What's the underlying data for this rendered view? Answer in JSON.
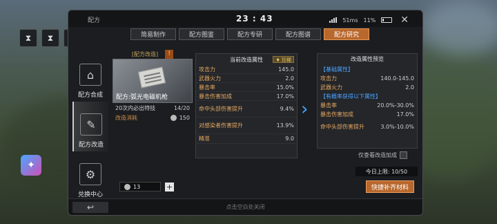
{
  "header": {
    "panel_title": "配方",
    "clock": "23 : 43",
    "network": "51ms",
    "battery": "11%",
    "close": "✕"
  },
  "tabs": [
    {
      "label": "简易制作",
      "active": false
    },
    {
      "label": "配方图鉴",
      "active": false
    },
    {
      "label": "配方专研",
      "active": false
    },
    {
      "label": "配方图谱",
      "active": false
    },
    {
      "label": "配方研究",
      "active": true
    }
  ],
  "sidebar": [
    {
      "label": "配方合成",
      "icon": "workbench-icon",
      "active": false
    },
    {
      "label": "配方改造",
      "icon": "clipboard-icon",
      "active": true
    },
    {
      "label": "兑换中心",
      "icon": "exchange-icon",
      "active": false
    }
  ],
  "blueprint": {
    "header": "[配方改造]",
    "info": "!",
    "name": "配方:弧光电磁机枪",
    "guarantee_label": "20次内必出特技",
    "guarantee_value": "14/20",
    "cost_label": "改造消耗",
    "cost_value": "150"
  },
  "current_stats": {
    "title": "当前改造属性",
    "badge": "珍稀",
    "rows": [
      {
        "key": "攻击力",
        "value": "145.0"
      },
      {
        "key": "武器火力",
        "value": "2.0"
      },
      {
        "key": "暴击率",
        "value": "15.0%"
      },
      {
        "key": "暴击伤害加成",
        "value": "17.0%"
      },
      {
        "key": "命中头部伤害提升",
        "value": "9.4%"
      },
      {
        "key": "对感染者伤害提升",
        "value": "13.9%"
      },
      {
        "key": "精准",
        "value": "9.0"
      }
    ]
  },
  "preview": {
    "title": "改造属性预览",
    "basic_label": "【基础属性】",
    "basic_rows": [
      {
        "key": "攻击力",
        "value": "140.0-145.0"
      },
      {
        "key": "武器火力",
        "value": "2.0"
      }
    ],
    "chance_label": "【有概率获得以下属性】",
    "chance_rows": [
      {
        "key": "暴击率",
        "value": "20.0%-30.0%"
      },
      {
        "key": "暴击伤害加成",
        "value": "17.0%"
      },
      {
        "key": "命中头部伤害提升",
        "value": "3.0%-10.0%"
      }
    ]
  },
  "only_improved_label": "仅查看改造加成",
  "daily_limit": "今日上限:  10/50",
  "refill_button": "快捷补齐材料",
  "quantity": "13",
  "footer_hint": "点击空白处关闭"
}
